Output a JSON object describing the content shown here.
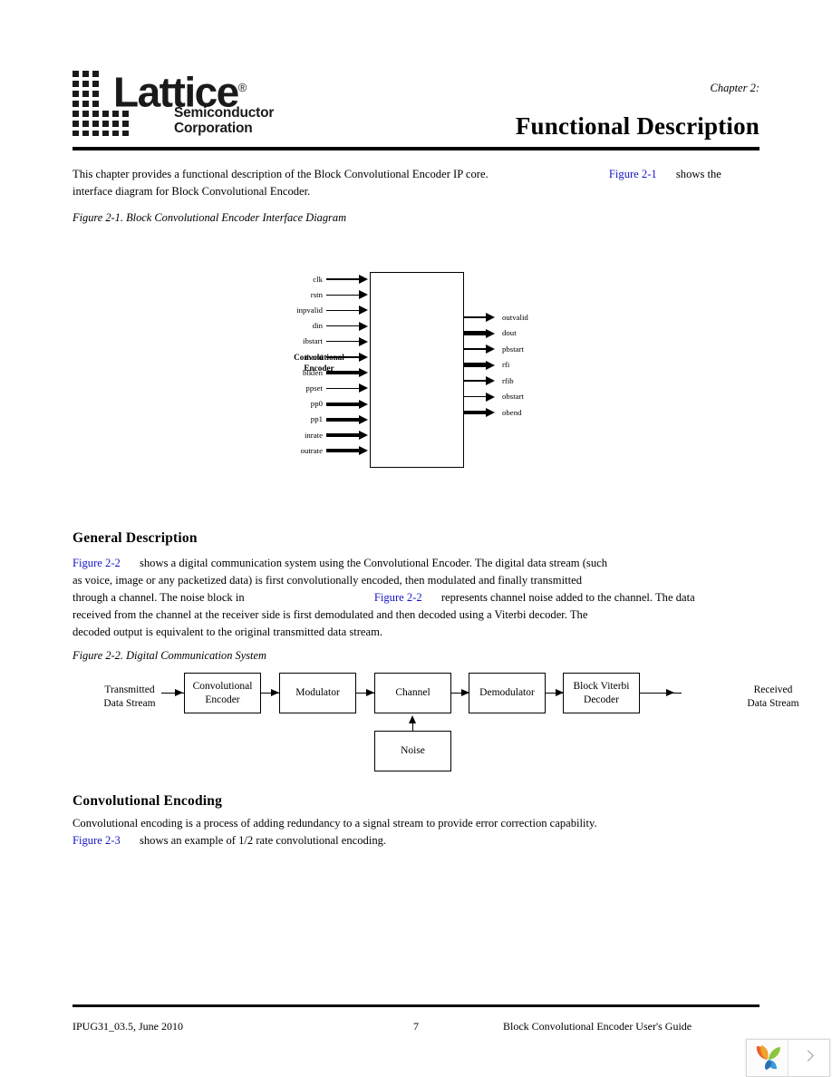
{
  "header": {
    "logo_word": "Lattice",
    "logo_reg": "®",
    "logo_sub_line1": "Semiconductor",
    "logo_sub_line2": "Corporation",
    "chapter_label": "Chapter 2:",
    "chapter_title": "Functional Description"
  },
  "intro": {
    "text_a": "This chapter provides a functional description of the Block Convolutional Encoder IP core.",
    "link": "Figure 2-1",
    "text_b": "shows the",
    "line2": "interface diagram for Block Convolutional Encoder."
  },
  "figure21": {
    "caption": "Figure 2-1. Block Convolutional Encoder Interface Diagram",
    "block_label_line1": "Convolutional",
    "block_label_line2": "Encoder",
    "inputs": [
      {
        "name": "clk",
        "bus": false
      },
      {
        "name": "rstn",
        "bus": false
      },
      {
        "name": "inpvalid",
        "bus": false
      },
      {
        "name": "din",
        "bus": false
      },
      {
        "name": "ibstart",
        "bus": false
      },
      {
        "name": "ibend",
        "bus": false
      },
      {
        "name": "blklen",
        "bus": true
      },
      {
        "name": "ppset",
        "bus": false
      },
      {
        "name": "pp0",
        "bus": true
      },
      {
        "name": "pp1",
        "bus": true
      },
      {
        "name": "inrate",
        "bus": true
      },
      {
        "name": "outrate",
        "bus": true
      }
    ],
    "outputs": [
      {
        "name": "outvalid",
        "bus": false
      },
      {
        "name": "dout",
        "bus": true
      },
      {
        "name": "pbstart",
        "bus": false
      },
      {
        "name": "rfi",
        "bus": true
      },
      {
        "name": "rfib",
        "bus": false
      },
      {
        "name": "obstart",
        "bus": false
      },
      {
        "name": "obend",
        "bus": true
      }
    ]
  },
  "general_description": {
    "heading": "General Description",
    "link1": "Figure 2-2",
    "line1_rest": "shows a digital communication system using the Convolutional Encoder. The digital data stream (such",
    "line2": "as voice, image or any packetized data) is first convolutionally encoded, then modulated and finally transmitted",
    "line3_a": "through a channel. The noise block in",
    "link2": "Figure 2-2",
    "line3_b": "represents channel noise added to the channel. The data",
    "line4": "received from the channel at the receiver side is first demodulated and then decoded using a Viterbi decoder. The",
    "line5": "decoded output is equivalent to the original transmitted data stream."
  },
  "figure22": {
    "caption": "Figure 2-2. Digital Communication System",
    "source_line1": "Transmitted",
    "source_line2": "Data Stream",
    "blocks": [
      {
        "line1": "Convolutional",
        "line2": "Encoder"
      },
      {
        "line1": "Modulator",
        "line2": ""
      },
      {
        "line1": "Channel",
        "line2": ""
      },
      {
        "line1": "Demodulator",
        "line2": ""
      },
      {
        "line1": "Block Viterbi",
        "line2": "Decoder"
      }
    ],
    "noise_block": "Noise",
    "sink_line1": "Received",
    "sink_line2": "Data Stream"
  },
  "convolutional_encoding": {
    "heading": "Convolutional Encoding",
    "line1": "Convolutional encoding is a process of adding redundancy to a signal stream to provide error correction capability.",
    "link": "Figure 2-3",
    "line2_rest": "shows an example of 1/2 rate convolutional encoding."
  },
  "footer": {
    "left": "IPUG31_03.5, June 2010",
    "page_number": "7",
    "right": "Block Convolutional Encoder User's Guide"
  },
  "viewer": {
    "logo_alt": "leaf-logo",
    "next_alt": "next-page"
  },
  "colors": {
    "link": "#1414c8",
    "text": "#000000",
    "rule": "#000000"
  }
}
